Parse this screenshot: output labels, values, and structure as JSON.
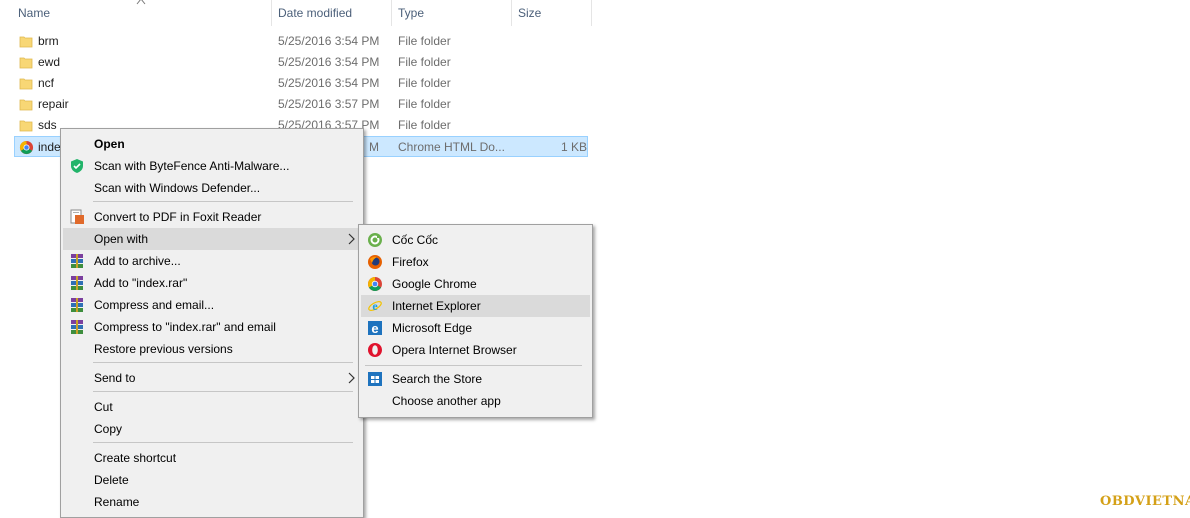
{
  "columns": {
    "name": "Name",
    "date_modified": "Date modified",
    "type": "Type",
    "size": "Size"
  },
  "files": [
    {
      "name": "brm",
      "date": "5/25/2016 3:54 PM",
      "type": "File folder",
      "size": ""
    },
    {
      "name": "ewd",
      "date": "5/25/2016 3:54 PM",
      "type": "File folder",
      "size": ""
    },
    {
      "name": "ncf",
      "date": "5/25/2016 3:54 PM",
      "type": "File folder",
      "size": ""
    },
    {
      "name": "repair",
      "date": "5/25/2016 3:57 PM",
      "type": "File folder",
      "size": ""
    },
    {
      "name": "sds",
      "date": "5/25/2016 3:57 PM",
      "type": "File folder",
      "size": ""
    },
    {
      "name": "inde",
      "date": "M",
      "type": "Chrome HTML Do...",
      "size": "1 KB"
    }
  ],
  "context_menu": {
    "open": "Open",
    "scan_bytefence": "Scan with ByteFence Anti-Malware...",
    "scan_defender": "Scan with Windows Defender...",
    "convert_pdf": "Convert to PDF in Foxit Reader",
    "open_with": "Open with",
    "add_archive": "Add to archive...",
    "add_rar": "Add to \"index.rar\"",
    "compress_email": "Compress and email...",
    "compress_rar_email": "Compress to \"index.rar\" and email",
    "restore": "Restore previous versions",
    "send_to": "Send to",
    "cut": "Cut",
    "copy": "Copy",
    "create_shortcut": "Create shortcut",
    "delete": "Delete",
    "rename": "Rename"
  },
  "open_with_menu": {
    "coc_coc": "Cốc Cốc",
    "firefox": "Firefox",
    "chrome": "Google Chrome",
    "ie": "Internet Explorer",
    "edge": "Microsoft Edge",
    "opera": "Opera Internet Browser",
    "store": "Search the Store",
    "another": "Choose another app"
  },
  "watermark": "OBDVIETNAM",
  "colors": {
    "selection": "#cce8ff",
    "menu_bg": "#f0f0f0",
    "menu_highlight": "#dadada",
    "header_text": "#4c607a",
    "folder": "#f8d775",
    "watermark": "#d4a017"
  }
}
